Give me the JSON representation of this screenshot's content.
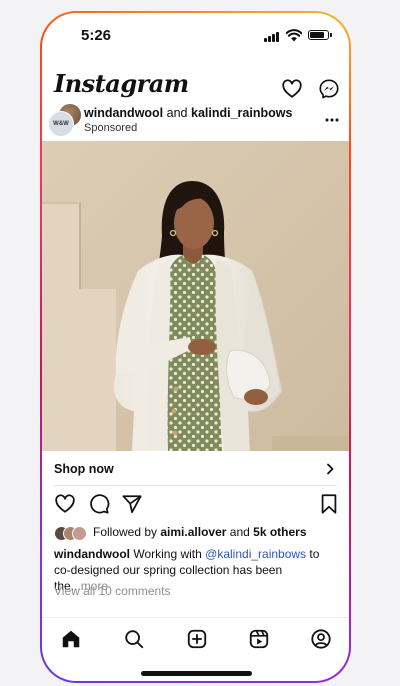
{
  "status_bar": {
    "time": "5:26"
  },
  "header": {
    "logo": "Instagram",
    "icons": [
      "heart-icon",
      "messenger-icon"
    ]
  },
  "post": {
    "author_primary": "windandwool",
    "author_connector": "and",
    "author_secondary": "kalindi_rainbows",
    "sponsored_label": "Sponsored",
    "avatar_initials": "W&W",
    "photo_description_icon": "photo",
    "cta_label": "Shop now",
    "liked_prefix": "Followed by",
    "liked_user": "aimi.allover",
    "liked_and": "and",
    "liked_count": "5k others",
    "caption_user": "windandwool",
    "caption_text_1": "Working with",
    "caption_mention": "@kalindi_rainbows",
    "caption_text_2": "to co-designed our spring collection has been the...",
    "caption_more": "more",
    "view_comments": "View all 10 comments"
  },
  "tabs": [
    "home-icon",
    "search-icon",
    "create-icon",
    "reels-icon",
    "profile-icon"
  ],
  "colors": {
    "mention": "#2b58b8",
    "muted": "#8e8e8e",
    "frame_top": "#f7b733",
    "frame_bottom": "#6a36e8"
  }
}
